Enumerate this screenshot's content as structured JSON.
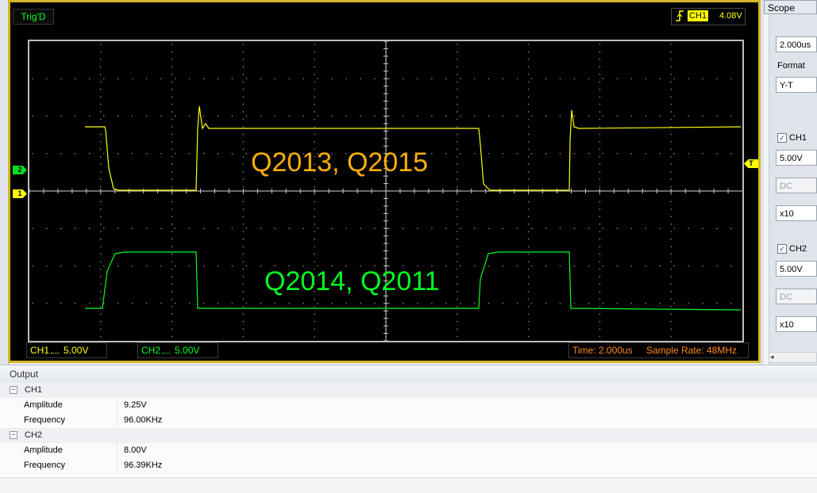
{
  "scope": {
    "trig_status": "Trig'D",
    "trigger_channel": "CH1",
    "trigger_level": "4.08V",
    "ch1_marker": "1",
    "ch2_marker": "2",
    "trigger_marker": "T",
    "ch1_label": "Q2013, Q2015",
    "ch2_label": "Q2014, Q2011",
    "ch1_scale_label": "CH1",
    "ch1_scale_value": "5.00V",
    "ch2_scale_label": "CH2",
    "ch2_scale_value": "5.00V",
    "time_text": "Time: 2.000us",
    "sample_rate_text": "Sample Rate: 48MHz",
    "colors": {
      "ch1": "#ffff00",
      "ch2": "#00ff22",
      "label1": "#ffb000",
      "frame": "#d6b52a",
      "info": "#ff8c1a"
    }
  },
  "panel": {
    "title": "Scope",
    "timebase": "2.000us",
    "format_label": "Format",
    "format_value": "Y-T",
    "ch1_enabled_label": "CH1",
    "ch1_volts": "5.00V",
    "ch1_coupling": "DC",
    "ch1_probe": "x10",
    "ch2_enabled_label": "CH2",
    "ch2_volts": "5.00V",
    "ch2_coupling": "DC",
    "ch2_probe": "x10",
    "ch1_checked": true,
    "ch2_checked": true
  },
  "output": {
    "title": "Output",
    "groups": [
      {
        "name": "CH1",
        "amplitude_label": "Amplitude",
        "amplitude": "9.25V",
        "frequency_label": "Frequency",
        "frequency": "96.00KHz"
      },
      {
        "name": "CH2",
        "amplitude_label": "Amplitude",
        "amplitude": "8.00V",
        "frequency_label": "Frequency",
        "frequency": "96.39KHz"
      }
    ]
  }
}
